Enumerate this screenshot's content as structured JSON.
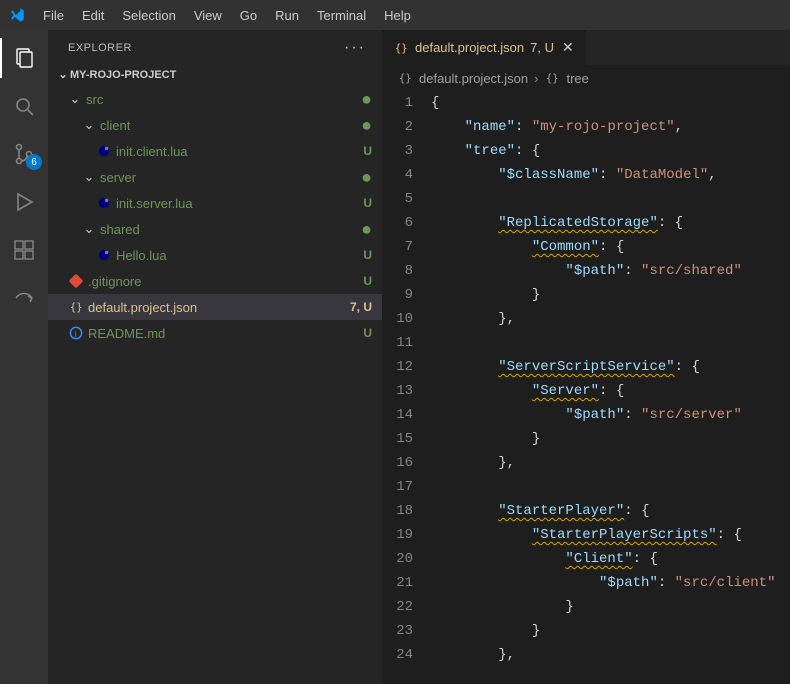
{
  "menu": [
    "File",
    "Edit",
    "Selection",
    "View",
    "Go",
    "Run",
    "Terminal",
    "Help"
  ],
  "activity": {
    "scm_badge": "6"
  },
  "explorer": {
    "title": "EXPLORER",
    "project": "MY-ROJO-PROJECT",
    "tree": {
      "src": {
        "label": "src",
        "deco": "dot"
      },
      "client": {
        "label": "client",
        "deco": "dot"
      },
      "init_client": {
        "label": "init.client.lua",
        "deco": "U"
      },
      "server": {
        "label": "server",
        "deco": "dot"
      },
      "init_server": {
        "label": "init.server.lua",
        "deco": "U"
      },
      "shared": {
        "label": "shared",
        "deco": "dot"
      },
      "hello": {
        "label": "Hello.lua",
        "deco": "U"
      },
      "gitignore": {
        "label": ".gitignore",
        "deco": "U"
      },
      "project": {
        "label": "default.project.json",
        "deco": "7, U"
      },
      "readme": {
        "label": "README.md",
        "deco": "U"
      }
    }
  },
  "tabs": {
    "active": {
      "label": "default.project.json",
      "suffix": "7, U"
    }
  },
  "breadcrumbs": {
    "file": "default.project.json",
    "node": "tree"
  },
  "code": {
    "lines": [
      {
        "n": 1,
        "t": "{"
      },
      {
        "n": 2,
        "t": "    \"name\": \"my-rojo-project\","
      },
      {
        "n": 3,
        "t": "    \"tree\": {"
      },
      {
        "n": 4,
        "t": "        \"$className\": \"DataModel\","
      },
      {
        "n": 5,
        "t": ""
      },
      {
        "n": 6,
        "t": "        \"ReplicatedStorage\": {"
      },
      {
        "n": 7,
        "t": "            \"Common\": {"
      },
      {
        "n": 8,
        "t": "                \"$path\": \"src/shared\""
      },
      {
        "n": 9,
        "t": "            }"
      },
      {
        "n": 10,
        "t": "        },"
      },
      {
        "n": 11,
        "t": ""
      },
      {
        "n": 12,
        "t": "        \"ServerScriptService\": {"
      },
      {
        "n": 13,
        "t": "            \"Server\": {"
      },
      {
        "n": 14,
        "t": "                \"$path\": \"src/server\""
      },
      {
        "n": 15,
        "t": "            }"
      },
      {
        "n": 16,
        "t": "        },"
      },
      {
        "n": 17,
        "t": ""
      },
      {
        "n": 18,
        "t": "        \"StarterPlayer\": {"
      },
      {
        "n": 19,
        "t": "            \"StarterPlayerScripts\": {"
      },
      {
        "n": 20,
        "t": "                \"Client\": {"
      },
      {
        "n": 21,
        "t": "                    \"$path\": \"src/client\""
      },
      {
        "n": 22,
        "t": "                }"
      },
      {
        "n": 23,
        "t": "            }"
      },
      {
        "n": 24,
        "t": "        },"
      }
    ]
  }
}
